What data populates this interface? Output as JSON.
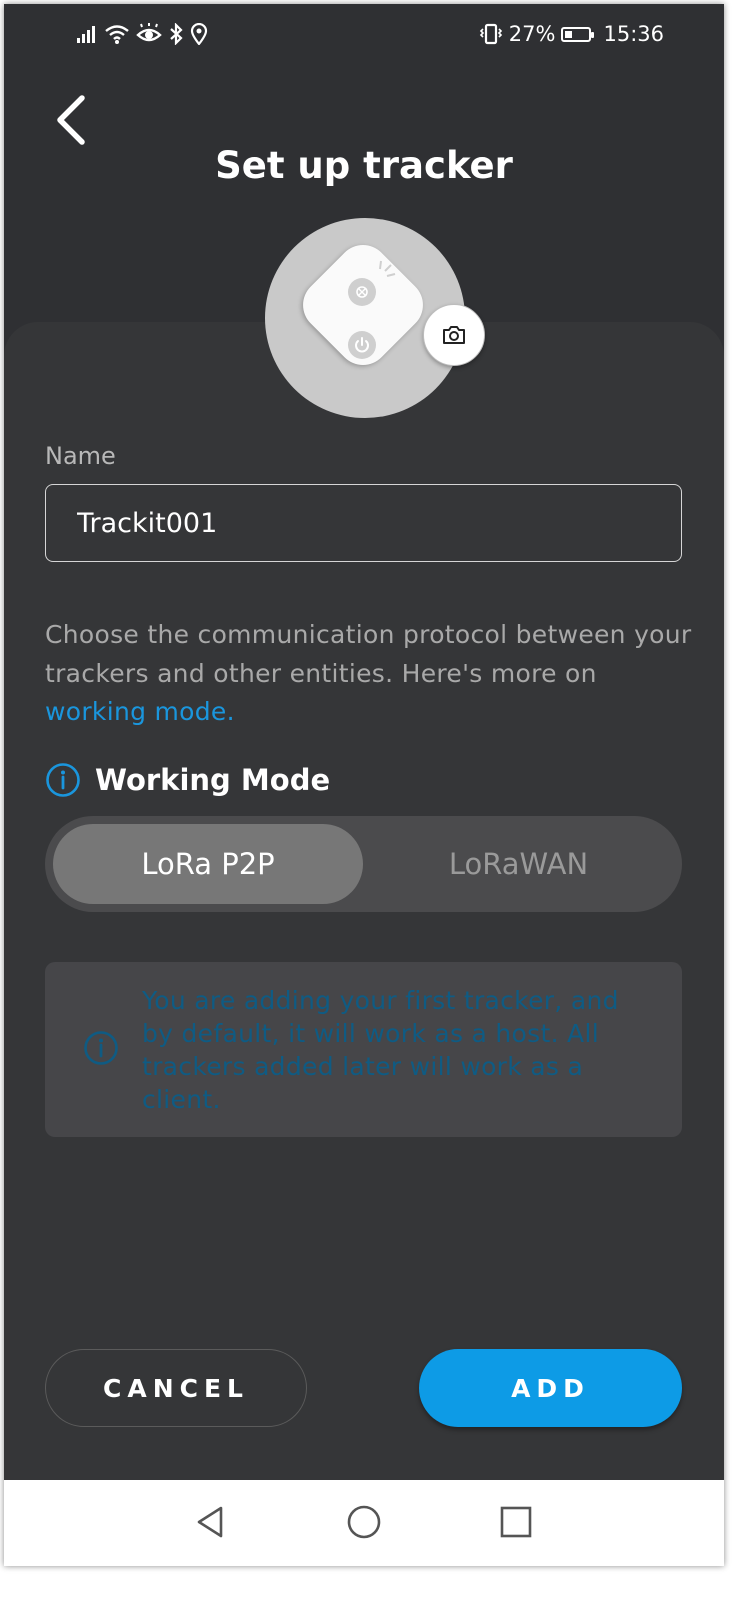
{
  "status_bar": {
    "battery_percent": "27%",
    "time": "15:36",
    "icons": [
      "signal-icon",
      "wifi-icon",
      "eye-icon",
      "bluetooth-icon",
      "location-icon",
      "vibrate-icon",
      "battery-icon"
    ]
  },
  "header": {
    "title": "Set up tracker",
    "back_icon": "chevron-left-icon"
  },
  "avatar": {
    "device_image": "tracker-device-image",
    "camera_icon": "camera-icon"
  },
  "name_field": {
    "label": "Name",
    "value": "Trackit001"
  },
  "description": {
    "text": "Choose the communication protocol between your trackers and other entities. Here's more on ",
    "link": "working mode."
  },
  "working_mode": {
    "title": "Working Mode",
    "options": [
      "LoRa P2P",
      "LoRaWAN"
    ],
    "selected": "LoRa P2P"
  },
  "info_box": {
    "text": "You are adding your first tracker, and by default, it will work as a host. All trackers added later will work as a client."
  },
  "buttons": {
    "cancel": "CANCEL",
    "add": "ADD"
  },
  "colors": {
    "background": "#2f3033",
    "card": "#353638",
    "accent": "#0d9be6",
    "link": "#1a96dd",
    "info_text": "#0f5b83"
  }
}
